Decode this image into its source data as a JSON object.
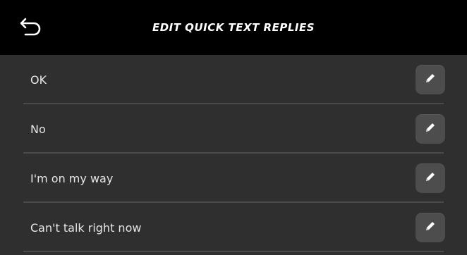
{
  "header": {
    "title": "EDIT QUICK TEXT REPLIES",
    "back_icon": "back-arrow-icon"
  },
  "replies": [
    {
      "label": "OK",
      "icon": "pencil-icon"
    },
    {
      "label": "No",
      "icon": "pencil-icon"
    },
    {
      "label": "I'm on my way",
      "icon": "pencil-icon"
    },
    {
      "label": "Can't talk right now",
      "icon": "pencil-icon"
    }
  ],
  "colors": {
    "header_bg": "#000000",
    "list_bg": "#2f2f2f",
    "button_bg": "#4d4d4d",
    "text": "#e6e6e6"
  }
}
